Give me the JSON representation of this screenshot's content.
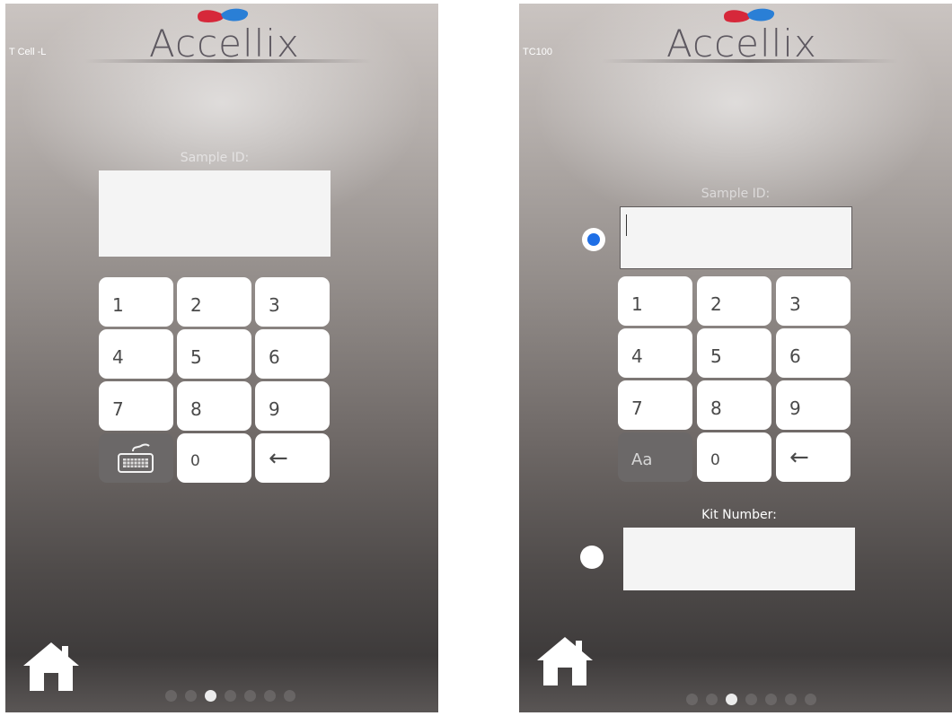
{
  "left_screen": {
    "device_label": "T Cell -L",
    "logo_text": "Accellix",
    "sample_id_label": "Sample ID:",
    "sample_id_value": "",
    "keypad": {
      "keys": [
        "1",
        "2",
        "3",
        "4",
        "5",
        "6",
        "7",
        "8",
        "9"
      ],
      "toggle_icon": "keyboard-icon",
      "zero": "0",
      "backspace": "←"
    },
    "home_icon": "home-icon",
    "page_indicator": {
      "total": 7,
      "active": 3
    }
  },
  "right_screen": {
    "device_label": "TC100",
    "logo_text": "Accellix",
    "sample_id_label": "Sample ID:",
    "sample_id_value": "",
    "sample_id_selected": true,
    "keypad": {
      "keys": [
        "1",
        "2",
        "3",
        "4",
        "5",
        "6",
        "7",
        "8",
        "9"
      ],
      "toggle_label": "Aa",
      "zero": "0",
      "backspace": "←"
    },
    "kit_number_label": "Kit Number:",
    "kit_number_value": "",
    "kit_number_selected": false,
    "home_icon": "home-icon",
    "page_indicator": {
      "total": 7,
      "active": 3
    }
  },
  "colors": {
    "radio_selected": "#1f6fe6",
    "key_background": "#ffffff",
    "key_dark": "#6b6868",
    "logo_red": "#d6283a",
    "logo_blue": "#2a7fd6"
  }
}
